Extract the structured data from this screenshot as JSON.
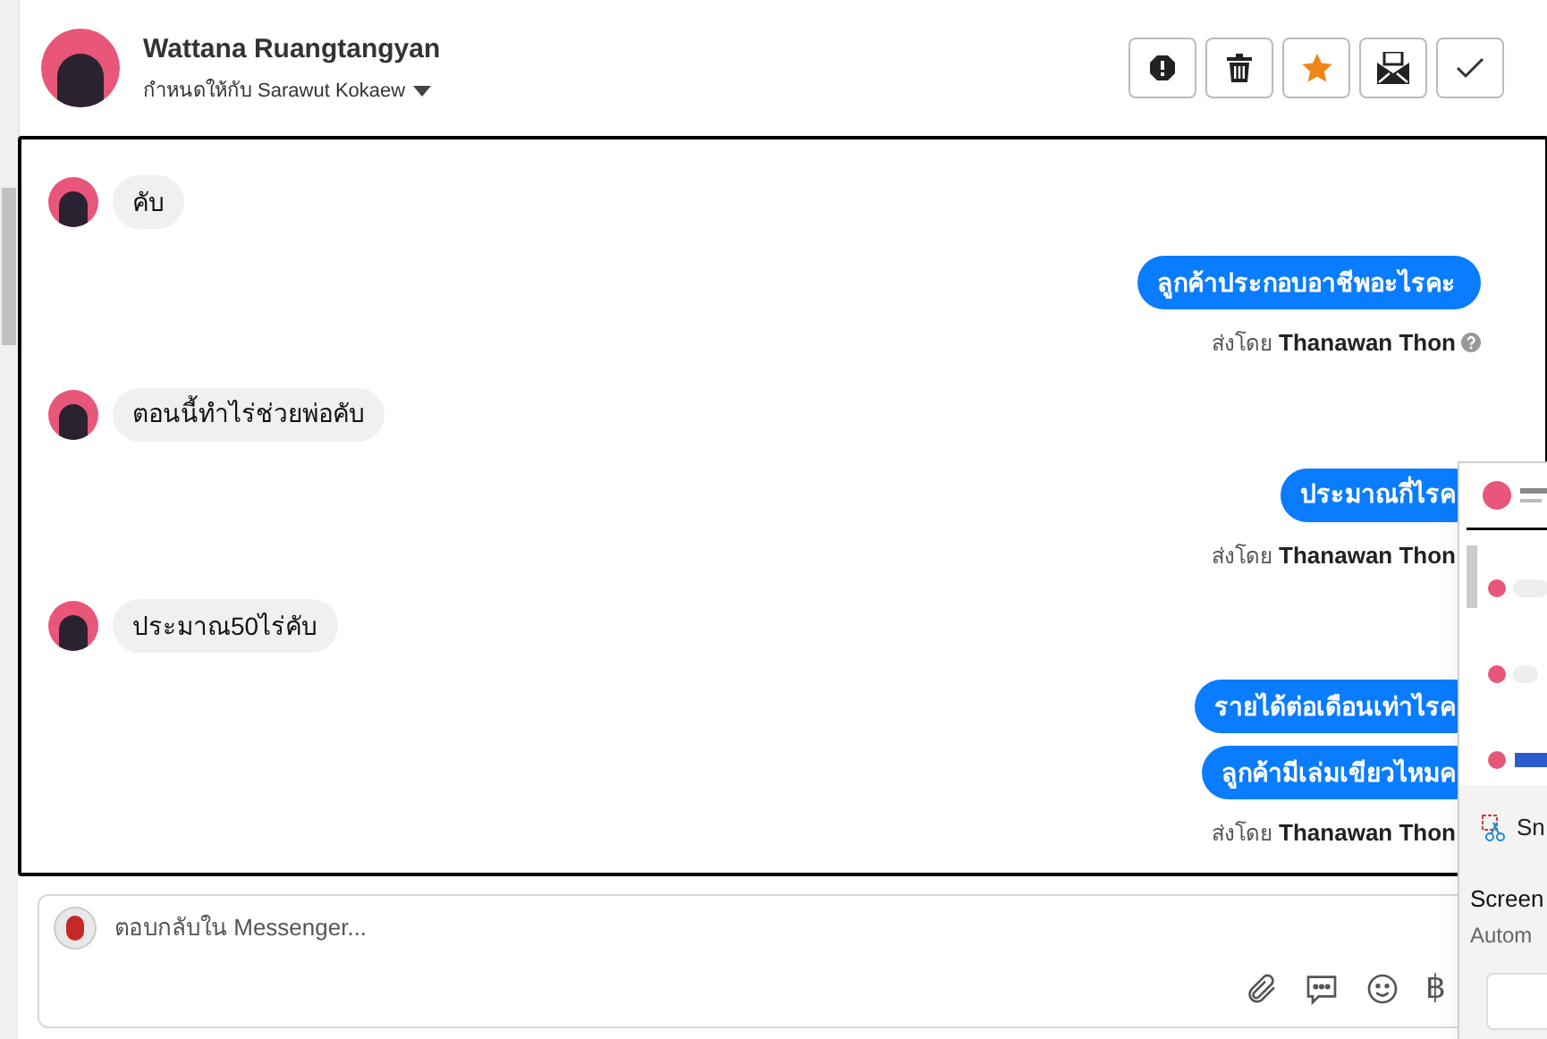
{
  "header": {
    "name": "Wattana Ruangtangyan",
    "assigned_label": "กำหนดให้กับ",
    "assignee": "Sarawut Kokaew"
  },
  "actions": [
    {
      "kind": "alert"
    },
    {
      "kind": "delete"
    },
    {
      "kind": "star"
    },
    {
      "kind": "mail"
    },
    {
      "kind": "done"
    }
  ],
  "messages": [
    {
      "kind": "incoming",
      "bubbles": [
        "คับ"
      ]
    },
    {
      "kind": "outgoing",
      "bubbles": [
        "ลูกค้าประกอบอาชีพอะไรคะ"
      ],
      "sent_by_label": "ส่งโดย",
      "sender": "Thanawan Thon",
      "help": true
    },
    {
      "kind": "incoming",
      "bubbles": [
        "ตอนนี้ทำไร่ช่วยพ่อคับ"
      ]
    },
    {
      "kind": "outgoing",
      "bubbles": [
        "ประมาณกี่ไรค"
      ],
      "sent_by_label": "ส่งโดย",
      "sender": "Thanawan Thon"
    },
    {
      "kind": "incoming",
      "bubbles": [
        "ประมาณ50ไร่คับ"
      ]
    },
    {
      "kind": "outgoing",
      "bubbles": [
        "รายได้ต่อเดือนเท่าไรค",
        "ลูกค้ามีเล่มเขียวไหมค"
      ],
      "sent_by_label": "ส่งโดย",
      "sender": "Thanawan Thon"
    }
  ],
  "composer": {
    "placeholder": "ตอบกลับใน Messenger...",
    "currency": "฿"
  },
  "popup": {
    "app_label": "Sn",
    "title": "Screen",
    "subtitle": "Autom"
  }
}
